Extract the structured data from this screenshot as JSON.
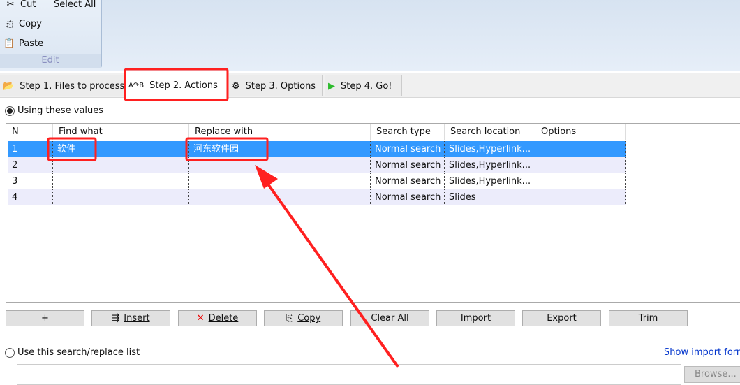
{
  "ribbon": {
    "cut": "Cut",
    "select_all": "Select All",
    "copy": "Copy",
    "paste": "Paste",
    "group_label": "Edit"
  },
  "tabs": [
    {
      "label": "Step 1. Files to process",
      "icon": "folder-open-icon"
    },
    {
      "label": "Step 2. Actions",
      "icon": "replace-ab-icon"
    },
    {
      "label": "Step 3. Options",
      "icon": "gear-icon"
    },
    {
      "label": "Step 4. Go!",
      "icon": "play-icon"
    }
  ],
  "mode": {
    "using_values": "Using these values",
    "use_list": "Use this search/replace list",
    "show_import": "Show import form",
    "list_value": "",
    "browse": "Browse..."
  },
  "table": {
    "columns": [
      "N",
      "Find what",
      "Replace with",
      "Search type",
      "Search location",
      "Options"
    ],
    "rows": [
      {
        "n": "1",
        "find": "软件",
        "replace": "河东软件园",
        "type": "Normal search",
        "location": "Slides,Hyperlink...",
        "options": ""
      },
      {
        "n": "2",
        "find": "",
        "replace": "",
        "type": "Normal search",
        "location": "Slides,Hyperlink...",
        "options": ""
      },
      {
        "n": "3",
        "find": "",
        "replace": "",
        "type": "Normal search",
        "location": "Slides,Hyperlink...",
        "options": ""
      },
      {
        "n": "4",
        "find": "",
        "replace": "",
        "type": "Normal search",
        "location": "Slides",
        "options": ""
      }
    ]
  },
  "buttons": {
    "add": "+",
    "insert": "Insert",
    "delete": "Delete",
    "copy": "Copy",
    "clear_all": "Clear All",
    "import": "Import",
    "export": "Export",
    "trim": "Trim"
  },
  "colors": {
    "selection": "#3399ff",
    "annotation": "#ff2020",
    "alt_row": "#ececfb"
  }
}
